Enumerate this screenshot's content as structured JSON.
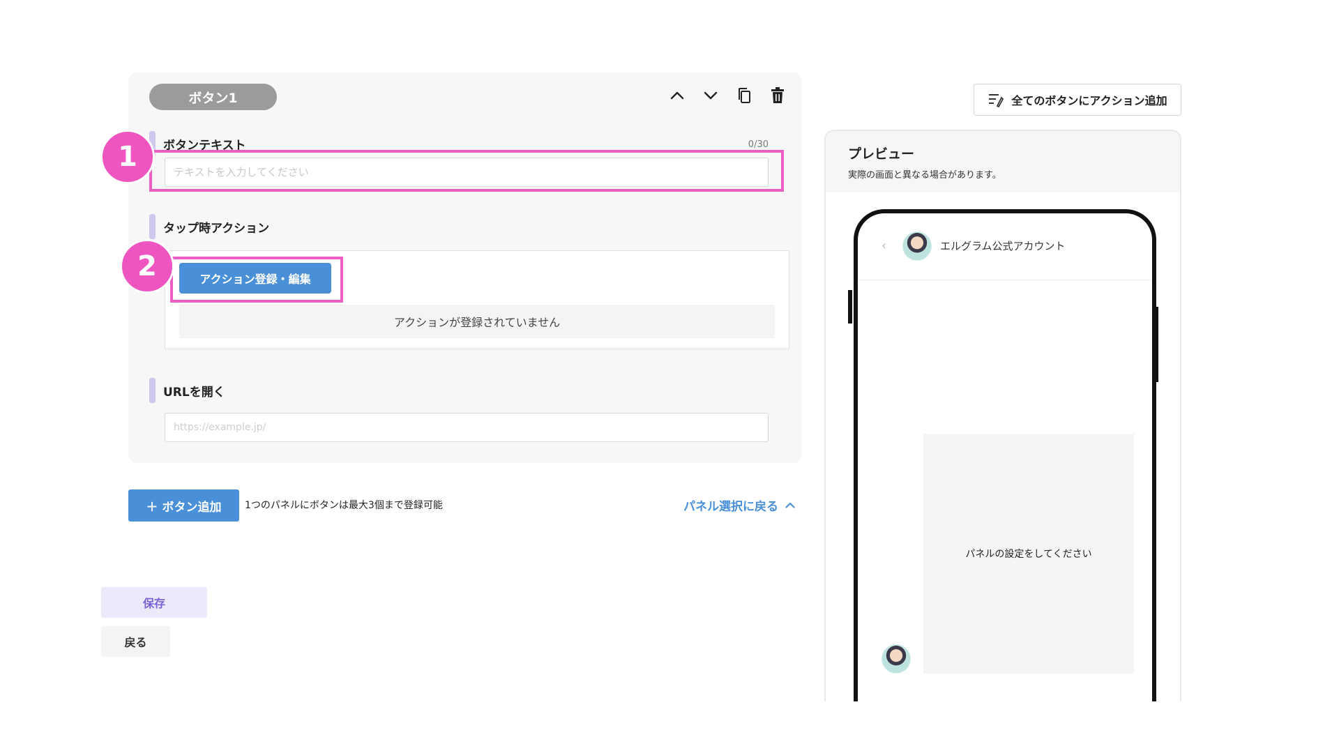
{
  "editor": {
    "button_tab_label": "ボタン1",
    "icons": [
      "chevron-up-icon",
      "chevron-down-icon",
      "copy-icon",
      "trash-icon"
    ],
    "button_text": {
      "label": "ボタンテキスト",
      "counter": "0/30",
      "value": "",
      "placeholder": "テキストを入力してください"
    },
    "tap_action": {
      "label": "タップ時アクション",
      "register_button": "アクション登録・編集",
      "empty_message": "アクションが登録されていません"
    },
    "open_url": {
      "label": "URLを開く",
      "value": "",
      "placeholder": "https://example.jp/"
    }
  },
  "annotations": {
    "step1": "1",
    "step2": "2",
    "highlight_color": "#ec5fc2"
  },
  "footer": {
    "add_button": "＋ ボタン追加",
    "add_note": "1つのパネルにボタンは最大3個まで登録可能",
    "back_to_panel": "パネル選択に戻る",
    "save": "保存",
    "back": "戻る"
  },
  "right": {
    "add_all_actions": "全てのボタンにアクション追加",
    "preview": {
      "title": "プレビュー",
      "subtitle": "実際の画面と異なる場合があります。",
      "account_name": "エルグラム公式アカウント",
      "panel_placeholder": "パネルの設定をしてください"
    }
  },
  "colors": {
    "accent_blue": "#4a90d9",
    "save_purple": "#7a62d6",
    "label_bar": "#cfc8ee"
  }
}
